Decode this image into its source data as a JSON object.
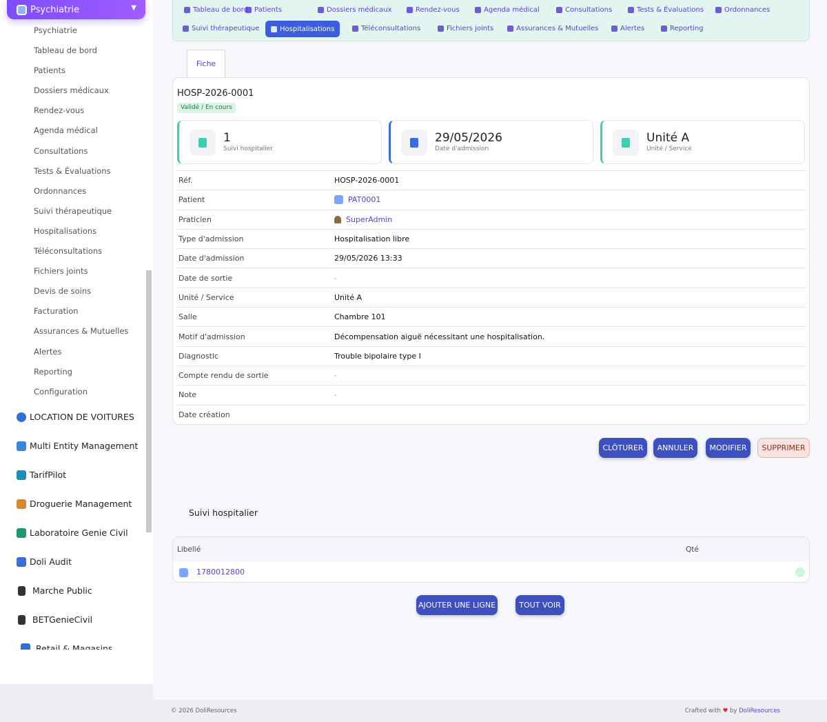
{
  "sidebar": {
    "module_title": "Psychiatrie",
    "items": [
      "Psychiatrie",
      "Tableau de bord",
      "Patients",
      "Dossiers médicaux",
      "Rendez-vous",
      "Agenda médical",
      "Consultations",
      "Tests & Évaluations",
      "Ordonnances",
      "Suivi thérapeutique",
      "Hospitalisations",
      "Téléconsultations",
      "Fichiers joints",
      "Devis de soins",
      "Facturation",
      "Assurances & Mutuelles",
      "Alertes",
      "Reporting",
      "Configuration"
    ],
    "other_modules": [
      "LOCATION DE VOITURES",
      "Multi Entity Management",
      "TarifPilot",
      "Droguerie Management",
      "Laboratoire Genie Civil",
      "Doli Audit",
      "Marche Public",
      "BETGenieCivil",
      "Retail & Magasins"
    ]
  },
  "topnav": {
    "row1": [
      "Tableau de bord",
      "Patients",
      "Dossiers médicaux",
      "Rendez-vous",
      "Agenda médical",
      "Consultations",
      "Tests & Évaluations",
      "Ordonnances"
    ],
    "row2": [
      "Suivi thérapeutique",
      "Hospitalisations",
      "Téléconsultations",
      "Fichiers joints",
      "Assurances & Mutuelles",
      "Alertes",
      "Reporting"
    ],
    "active": "Hospitalisations"
  },
  "record": {
    "tab": "Fiche",
    "ref": "HOSP-2026-0001",
    "status": "Validé / En cours",
    "stats": [
      {
        "value": "1",
        "label": "Suivi hospitalier"
      },
      {
        "value": "29/05/2026",
        "label": "Date d'admission"
      },
      {
        "value": "Unité A",
        "label": "Unité / Service"
      }
    ],
    "fields": [
      {
        "label": "Réf.",
        "value": "HOSP-2026-0001"
      },
      {
        "label": "Patient",
        "value": "PAT0001"
      },
      {
        "label": "Praticien",
        "value": "SuperAdmin"
      },
      {
        "label": "Type d'admission",
        "value": "Hospitalisation libre"
      },
      {
        "label": "Date d'admission",
        "value": "29/05/2026 13:33"
      },
      {
        "label": "Date de sortie",
        "value": "-"
      },
      {
        "label": "Unité / Service",
        "value": "Unité A"
      },
      {
        "label": "Salle",
        "value": "Chambre 101"
      },
      {
        "label": "Motif d'admission",
        "value": "Décompensation aiguë nécessitant une hospitalisation."
      },
      {
        "label": "Diagnostic",
        "value": "Trouble bipolaire type I"
      },
      {
        "label": "Compte rendu de sortie",
        "value": "-"
      },
      {
        "label": "Note",
        "value": "-"
      },
      {
        "label": "Date création",
        "value": ""
      }
    ]
  },
  "actions": {
    "close": "CLÔTURER",
    "cancel": "ANNULER",
    "edit": "MODIFIER",
    "delete": "SUPPRIMER"
  },
  "lines": {
    "title": "Suivi hospitalier",
    "col_label": "Libellé",
    "col_qty": "Qté",
    "rows": [
      {
        "label": "1780012800"
      }
    ],
    "add_label": "AJOUTER UNE LIGNE",
    "view_all_label": "TOUT VOIR"
  },
  "footer": {
    "copyright": "© 2026 DoliResources",
    "crafted": "Crafted with",
    "heart": "♥",
    "by": "by",
    "brand": "DoliResources"
  }
}
